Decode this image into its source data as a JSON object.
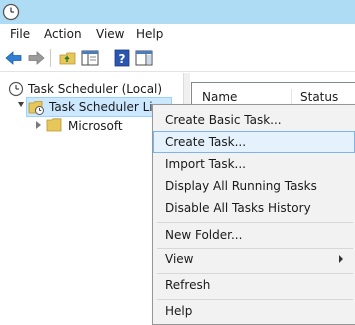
{
  "menubar": {
    "file": "File",
    "action": "Action",
    "view": "View",
    "help": "Help"
  },
  "toolbar": {
    "buttons": [
      "back-icon",
      "forward-icon",
      "up-folder-icon",
      "show-hide-tree-icon",
      "help-icon",
      "show-hide-action-pane-icon"
    ]
  },
  "tree": {
    "root": "Task Scheduler (Local)",
    "library": "Task Scheduler Li",
    "microsoft": "Microsoft"
  },
  "list": {
    "columns": [
      "Name",
      "Status"
    ]
  },
  "context_menu": {
    "create_basic_task": "Create Basic Task...",
    "create_task": "Create Task...",
    "import_task": "Import Task...",
    "display_running": "Display All Running Tasks",
    "disable_history": "Disable All Tasks History",
    "new_folder": "New Folder...",
    "view": "View",
    "refresh": "Refresh",
    "help": "Help"
  },
  "colors": {
    "titlebar": "#aedcf5",
    "selection": "#cce8ff",
    "menu_highlight": "#e5f1fb",
    "menu_highlight_border": "#7eb4ea"
  }
}
